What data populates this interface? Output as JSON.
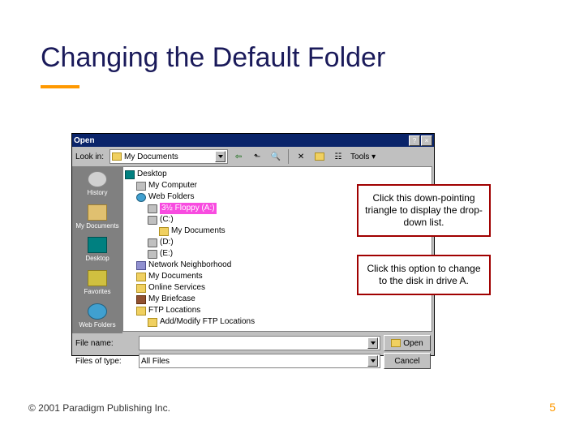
{
  "title": "Changing the Default Folder",
  "footer_left": "© 2001 Paradigm Publishing Inc.",
  "footer_right": "5",
  "dlg": {
    "title": "Open",
    "lookin_label": "Look in:",
    "lookin_value": "My Documents",
    "tools_label": "Tools",
    "places": {
      "history": "History",
      "mydocs": "My Documents",
      "desktop": "Desktop",
      "favorites": "Favorites",
      "webfolders": "Web Folders"
    },
    "tree": {
      "desktop": "Desktop",
      "mycomputer": "My Computer",
      "webfolders": "Web Folders",
      "floppy": "3½ Floppy (A:)",
      "c": "(C:)",
      "mydocs": "My Documents",
      "d": "(D:)",
      "e": "(E:)",
      "network": "Network Neighborhood",
      "mydocs2": "My Documents",
      "online": "Online Services",
      "briefcase": "My Briefcase",
      "ftp": "FTP Locations",
      "addftp": "Add/Modify FTP Locations"
    },
    "filename_label": "File name:",
    "filetype_label": "Files of type:",
    "filetype_value": "All Files",
    "open_btn": "Open",
    "cancel_btn": "Cancel"
  },
  "callouts": {
    "c1": "Click this down-pointing triangle to display the drop-down list.",
    "c2": "Click this option to change to the disk in drive A."
  }
}
